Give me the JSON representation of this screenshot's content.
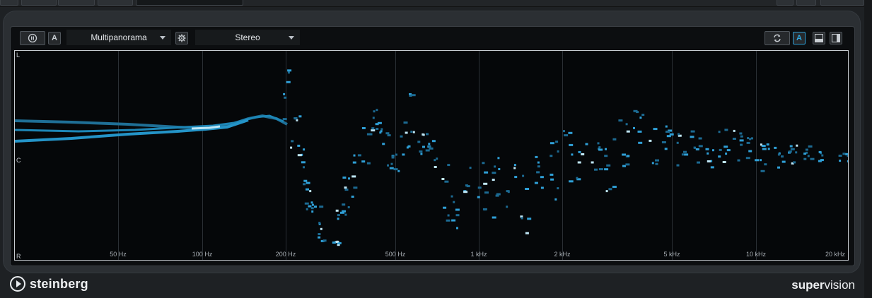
{
  "toolbar": {
    "pause_icon": "pause-icon",
    "a_left_label": "A",
    "mode_dropdown": "Multipanorama",
    "settings_icon": "gear-icon",
    "channel_dropdown": "Stereo",
    "sync_icon": "sync-icon",
    "a_right_label": "A",
    "layout_bottom_icon": "panel-bottom-icon",
    "layout_right_icon": "panel-right-icon"
  },
  "plot": {
    "y_labels": {
      "top": "L",
      "center": "C",
      "bottom": "R"
    },
    "x_ticks": [
      "50 Hz",
      "100 Hz",
      "200 Hz",
      "500 Hz",
      "1 kHz",
      "2 kHz",
      "5 kHz",
      "10 kHz",
      "20 kHz"
    ]
  },
  "footer": {
    "brand": "steinberg",
    "product_bold": "super",
    "product_regular": "vision"
  },
  "colors": {
    "accent": "#2f9fd6",
    "trace_bright": "#bfe6f5",
    "background": "#050709"
  }
}
